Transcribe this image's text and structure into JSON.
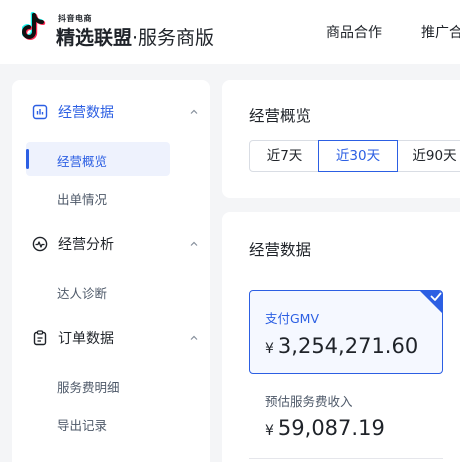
{
  "header": {
    "brand_small": "抖音电商",
    "brand_main": "精选联盟",
    "brand_sub": "·服务商版",
    "nav": [
      "商品合作",
      "推广合"
    ]
  },
  "sidebar": {
    "sections": [
      {
        "label": "经营数据",
        "icon": "bar-chart-icon",
        "expanded": true,
        "items": [
          {
            "label": "经营概览",
            "active": true
          },
          {
            "label": "出单情况",
            "active": false
          }
        ]
      },
      {
        "label": "经营分析",
        "icon": "pulse-icon",
        "expanded": true,
        "items": [
          {
            "label": "达人诊断",
            "active": false
          }
        ]
      },
      {
        "label": "订单数据",
        "icon": "clipboard-icon",
        "expanded": true,
        "items": [
          {
            "label": "服务费明细",
            "active": false
          },
          {
            "label": "导出记录",
            "active": false
          }
        ]
      }
    ]
  },
  "overview": {
    "title": "经营概览",
    "ranges": [
      "近7天",
      "近30天",
      "近90天"
    ],
    "selected_range": "近30天"
  },
  "business_data": {
    "title": "经营数据",
    "metrics": [
      {
        "label": "支付GMV",
        "currency": "¥",
        "value": "3,254,271.60",
        "selected": true
      },
      {
        "label": "预估服务费收入",
        "currency": "¥",
        "value": "59,087.19",
        "selected": false
      }
    ]
  },
  "colors": {
    "accent": "#2c5fe3",
    "brand_cyan": "#25f4ee",
    "brand_red": "#fe2c55"
  }
}
